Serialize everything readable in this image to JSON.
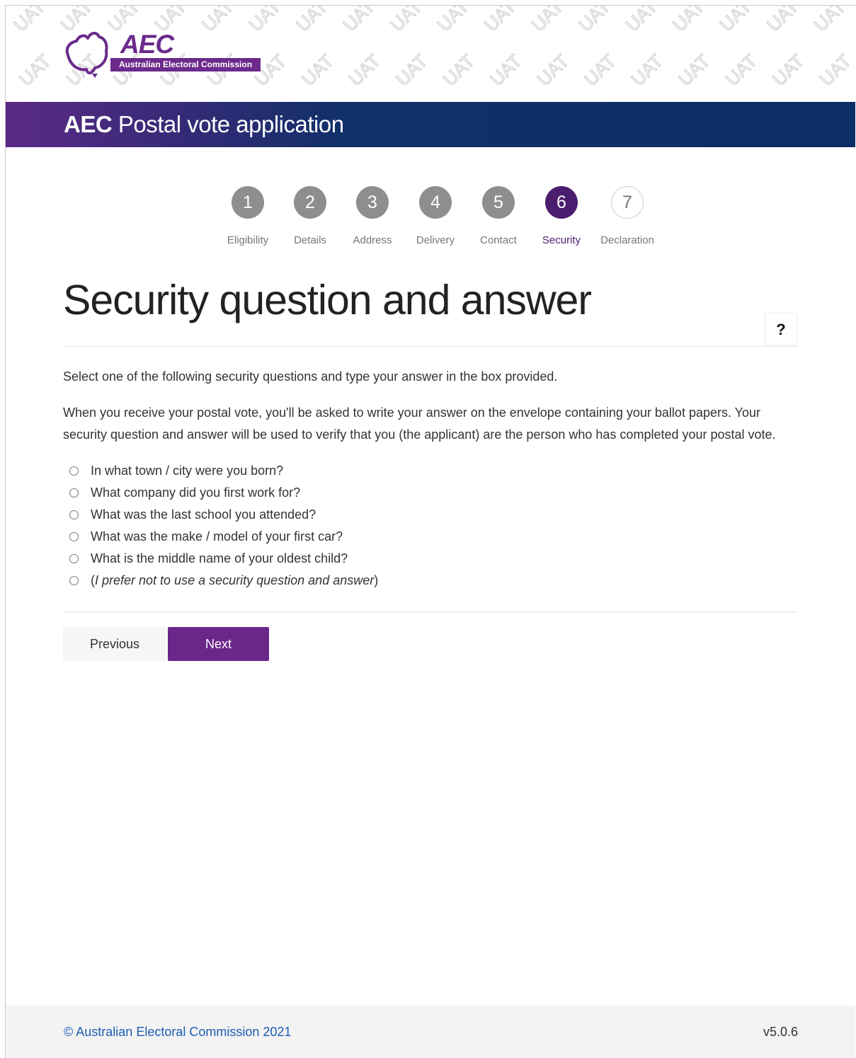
{
  "watermark_text": "UAT",
  "logo": {
    "wordmark": "AEC",
    "subtitle": "Australian Electoral Commission"
  },
  "header": {
    "title_bold": "AEC",
    "title_rest": " Postal vote application"
  },
  "steps": [
    {
      "number": "1",
      "label": "Eligibility",
      "state": "done"
    },
    {
      "number": "2",
      "label": "Details",
      "state": "done"
    },
    {
      "number": "3",
      "label": "Address",
      "state": "done"
    },
    {
      "number": "4",
      "label": "Delivery",
      "state": "done"
    },
    {
      "number": "5",
      "label": "Contact",
      "state": "done"
    },
    {
      "number": "6",
      "label": "Security",
      "state": "active"
    },
    {
      "number": "7",
      "label": "Declaration",
      "state": "future"
    }
  ],
  "page": {
    "title": "Security question and answer",
    "help_label": "?",
    "intro": "Select one of the following security questions and type your answer in the box provided.",
    "explanation": "When you receive your postal vote, you'll be asked to write your answer on the envelope containing your ballot papers. Your security question and answer will be used to verify that you (the applicant) are the person who has completed your postal vote."
  },
  "questions": [
    "In what town / city were you born?",
    "What company did you first work for?",
    "What was the last school you attended?",
    "What was the make / model of your first car?",
    "What is the middle name of your oldest child?"
  ],
  "opt_out": {
    "open_paren": "(",
    "italic_text": "I prefer not to use a security question and answer",
    "close_paren": ")"
  },
  "buttons": {
    "previous": "Previous",
    "next": "Next"
  },
  "footer": {
    "copyright": "© Australian Electoral Commission 2021",
    "version": "v5.0.6"
  },
  "colors": {
    "brand_purple": "#6a2689",
    "active_step": "#4a1d6e",
    "header_navy": "#0b2e66",
    "link_blue": "#1c5db5"
  }
}
